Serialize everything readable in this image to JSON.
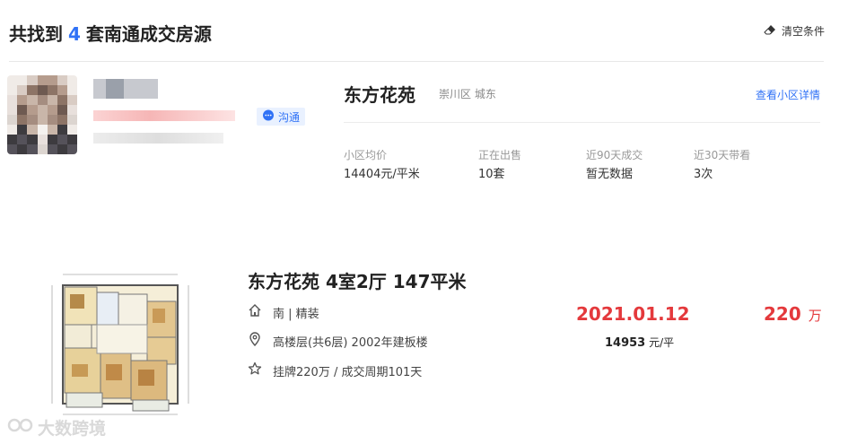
{
  "header": {
    "title_prefix": "共找到",
    "count": "4",
    "title_suffix": "套南通成交房源",
    "clear_label": "清空条件"
  },
  "agent": {
    "chat_label": "沟通"
  },
  "community": {
    "name": "东方花苑",
    "area": "崇川区 城东",
    "detail_link": "查看小区详情",
    "stats": [
      {
        "label": "小区均价",
        "value": "14404元/平米"
      },
      {
        "label": "正在出售",
        "value": "10套"
      },
      {
        "label": "近90天成交",
        "value": "暂无数据"
      },
      {
        "label": "近30天带看",
        "value": "3次"
      }
    ]
  },
  "listing": {
    "title": "东方花苑 4室2厅 147平米",
    "orientation": "南 | 精装",
    "floor_info": "高楼层(共6层) 2002年建板楼",
    "listing_info": "挂牌220万 / 成交周期101天",
    "deal_date": "2021.01.12",
    "deal_price": "220",
    "deal_price_unit": "万",
    "unit_price": "14953",
    "unit_price_unit": "元/平"
  },
  "watermark": "大数跨境",
  "colors": {
    "accent_blue": "#3072f6",
    "price_red": "#e4393c",
    "muted_gray": "#999999"
  },
  "icons": [
    "eraser-icon",
    "chat-bubble-icon",
    "house-icon",
    "location-pin-icon",
    "star-icon"
  ]
}
